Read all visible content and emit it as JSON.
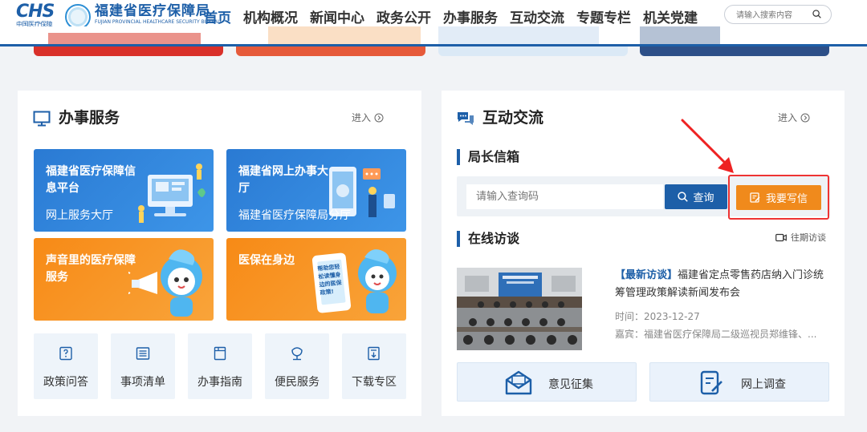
{
  "header": {
    "logo_text": "CHS",
    "logo_sub": "中国医疗保障",
    "site_name": "福建省医疗保障局",
    "site_name_en": "FUJIAN PROVINCIAL HEALTHCARE SECURITY BUREAU",
    "nav": [
      "首页",
      "机构概况",
      "新闻中心",
      "政务公开",
      "办事服务",
      "互动交流",
      "专题专栏",
      "机关党建"
    ],
    "active_nav": 0,
    "search_placeholder": "请输入搜索内容"
  },
  "service": {
    "title": "办事服务",
    "enter_label": "进入",
    "cards": [
      {
        "title": "福建省医疗保障信息平台",
        "subtitle": "网上服务大厅"
      },
      {
        "title": "福建省网上办事大厅",
        "subtitle": "福建省医疗保障局分厅"
      },
      {
        "title": "声音里的医疗保障服务",
        "subtitle": ""
      },
      {
        "title": "医保在身边",
        "subtitle": ""
      }
    ],
    "phone_text": "帮助您轻松读懂身边的医保政策!",
    "quick_links": [
      "政策问答",
      "事项清单",
      "办事指南",
      "便民服务",
      "下载专区"
    ]
  },
  "interaction": {
    "title": "互动交流",
    "enter_label": "进入",
    "mailbox_title": "局长信箱",
    "query_placeholder": "请输入查询码",
    "query_button": "查询",
    "write_button": "我要写信",
    "online_title": "在线访谈",
    "past_label": "往期访谈",
    "interview": {
      "tag": "【最新访谈】",
      "title": "福建省定点零售药店纳入门诊统筹管理政策解读新闻发布会",
      "time": "时间：2023-12-27",
      "guest": "嘉宾：福建省医疗保障局二级巡视员郑维锋、..."
    },
    "actions": [
      "意见征集",
      "网上调查"
    ]
  },
  "colors": {
    "brand_blue": "#1d5fa8",
    "card_blue": "#2b7fd6",
    "card_orange": "#f7941e",
    "write_orange": "#f08a1c",
    "highlight_red": "#ee2222"
  }
}
